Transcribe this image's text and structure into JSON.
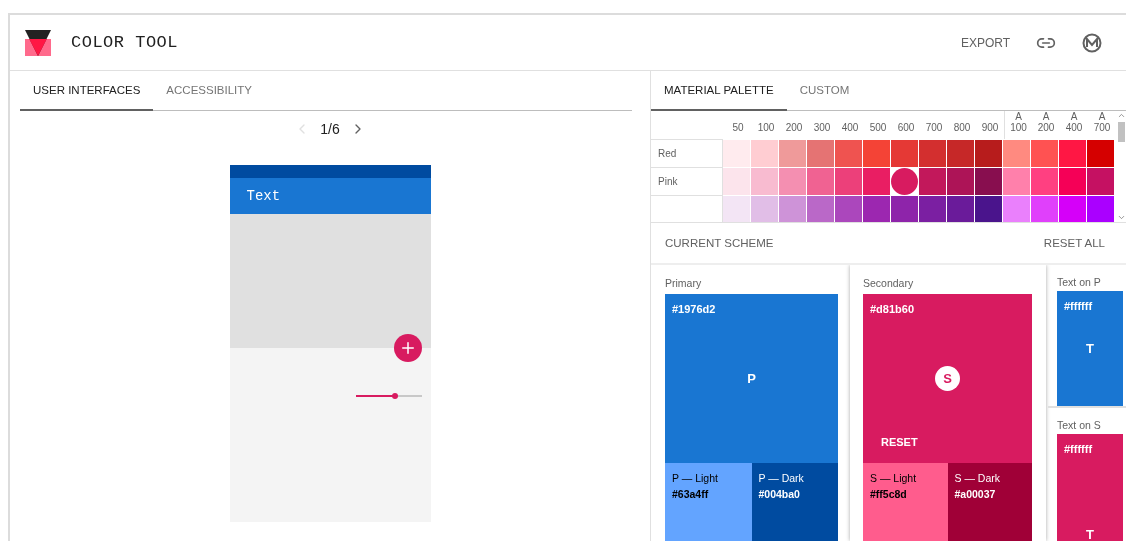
{
  "app": {
    "title": "COLOR TOOL",
    "actions": [
      {
        "kind": "text",
        "label": "EXPORT"
      },
      {
        "kind": "link"
      },
      {
        "kind": "logo"
      }
    ]
  },
  "left_panel": {
    "tabs": [
      {
        "label": "USER INTERFACES",
        "selected": true
      },
      {
        "label": "ACCESSIBILITY",
        "selected": false
      }
    ],
    "pager": {
      "text": "1/6",
      "prev_disabled": true,
      "next_disabled": false
    },
    "preview": {
      "app_bar_title": "Text",
      "slider": {
        "level": 0.6
      }
    }
  },
  "right_panel": {
    "tabs": [
      {
        "label": "MATERIAL PALETTE",
        "selected": true
      },
      {
        "label": "CUSTOM",
        "selected": false
      }
    ],
    "palette": {
      "columns": [
        {
          "label": "50"
        },
        {
          "label": "100"
        },
        {
          "label": "200"
        },
        {
          "label": "300"
        },
        {
          "label": "400"
        },
        {
          "label": "500"
        },
        {
          "label": "600"
        },
        {
          "label": "700"
        },
        {
          "label": "800"
        },
        {
          "label": "900"
        },
        {
          "prefix": "A",
          "label": "100"
        },
        {
          "prefix": "A",
          "label": "200"
        },
        {
          "prefix": "A",
          "label": "400"
        },
        {
          "prefix": "A",
          "label": "700"
        }
      ],
      "rows": [
        {
          "name": "Red",
          "swatches": [
            {
              "color": "#ffebee",
              "selected": false
            },
            {
              "color": "#ffcdd2",
              "selected": false
            },
            {
              "color": "#ef9a9a",
              "selected": false
            },
            {
              "color": "#e57373",
              "selected": false
            },
            {
              "color": "#ef5350",
              "selected": false
            },
            {
              "color": "#f44336",
              "selected": false
            },
            {
              "color": "#e53935",
              "selected": false
            },
            {
              "color": "#d32f2f",
              "selected": false
            },
            {
              "color": "#c62828",
              "selected": false
            },
            {
              "color": "#b71c1c",
              "selected": false
            },
            {
              "color": "#ff8a80",
              "selected": false
            },
            {
              "color": "#ff5252",
              "selected": false
            },
            {
              "color": "#ff1744",
              "selected": false
            },
            {
              "color": "#d50000",
              "selected": false
            }
          ]
        },
        {
          "name": "Pink",
          "swatches": [
            {
              "color": "#fce4ec",
              "selected": false
            },
            {
              "color": "#f8bbd0",
              "selected": false
            },
            {
              "color": "#f48fb1",
              "selected": false
            },
            {
              "color": "#f06292",
              "selected": false
            },
            {
              "color": "#ec407a",
              "selected": false
            },
            {
              "color": "#e91e63",
              "selected": false
            },
            {
              "color": "#d81b60",
              "selected": true
            },
            {
              "color": "#c2185b",
              "selected": false
            },
            {
              "color": "#ad1457",
              "selected": false
            },
            {
              "color": "#880e4f",
              "selected": false
            },
            {
              "color": "#ff80ab",
              "selected": false
            },
            {
              "color": "#ff4081",
              "selected": false
            },
            {
              "color": "#f50057",
              "selected": false
            },
            {
              "color": "#c51162",
              "selected": false
            }
          ]
        },
        {
          "swatches": [
            {
              "color": "#f3e5f5",
              "selected": false
            },
            {
              "color": "#e1bee7",
              "selected": false
            },
            {
              "color": "#ce93d8",
              "selected": false
            },
            {
              "color": "#ba68c8",
              "selected": false
            },
            {
              "color": "#ab47bc",
              "selected": false
            },
            {
              "color": "#9c27b0",
              "selected": false
            },
            {
              "color": "#8e24aa",
              "selected": false
            },
            {
              "color": "#7b1fa2",
              "selected": false
            },
            {
              "color": "#6a1b9a",
              "selected": false
            },
            {
              "color": "#4a148c",
              "selected": false
            },
            {
              "color": "#ea80fc",
              "selected": false
            },
            {
              "color": "#e040fb",
              "selected": false
            },
            {
              "color": "#d500f9",
              "selected": false
            },
            {
              "color": "#aa00ff",
              "selected": false
            }
          ]
        }
      ]
    },
    "scheme": {
      "title": "CURRENT SCHEME",
      "reset_all": "RESET ALL",
      "cards": [
        {
          "kind": "main",
          "label": "Primary",
          "selected": false,
          "hex": "#1976d2",
          "color": "#1976d2",
          "letter": "P",
          "variants": [
            {
              "label": "P — Light",
              "hex": "#63a4ff",
              "color": "#63a4ff"
            },
            {
              "label": "P — Dark",
              "hex": "#004ba0",
              "color": "#004ba0"
            }
          ]
        },
        {
          "kind": "main",
          "label": "Secondary",
          "selected": true,
          "hex": "#d81b60",
          "color": "#d81b60",
          "letter": "S",
          "reset": "RESET",
          "variants": [
            {
              "label": "S — Light",
              "hex": "#ff5c8d",
              "color": "#ff5c8d"
            },
            {
              "label": "S — Dark",
              "hex": "#a00037",
              "color": "#a00037"
            }
          ]
        }
      ],
      "text_cards": [
        {
          "label": "Text on P",
          "hex": "#ffffff",
          "color": "#1976d2",
          "letter": "T"
        },
        {
          "label": "Text on S",
          "hex": "#ffffff",
          "color": "#d81b60",
          "letter": "T"
        }
      ]
    }
  }
}
